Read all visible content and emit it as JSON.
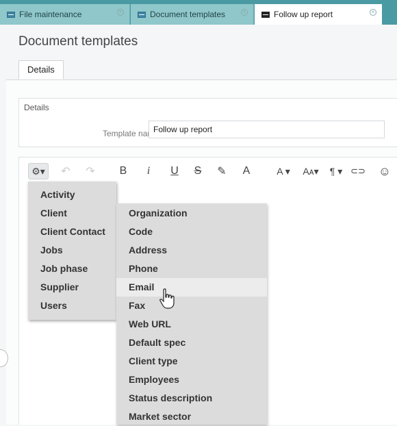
{
  "tabs": [
    {
      "label": "File maintenance"
    },
    {
      "label": "Document templates"
    },
    {
      "label": "Follow up report"
    }
  ],
  "page_title": "Document templates",
  "subtab": "Details",
  "group": {
    "label": "Details",
    "field_label": "Template name",
    "field_value": "Follow up report"
  },
  "toolbar": {
    "gear": "⚙▾",
    "undo": "↶",
    "redo": "↷",
    "bold": "B",
    "italic": "i",
    "underline": "U",
    "strike": "S",
    "highlight": "✎",
    "text_color": "A",
    "font": "A ▾",
    "font_size": "Aᴀ▾",
    "paragraph": "¶ ▾",
    "link": "⊂⊃",
    "emoji": "☺"
  },
  "menu_primary": [
    "Activity",
    "Client",
    "Client Contact",
    "Jobs",
    "Job phase",
    "Supplier",
    "Users"
  ],
  "menu_secondary": [
    "Organization",
    "Code",
    "Address",
    "Phone",
    "Email",
    "Fax",
    "Web URL",
    "Default spec",
    "Client type",
    "Employees",
    "Status description",
    "Market sector"
  ],
  "hovered_item": "Email"
}
